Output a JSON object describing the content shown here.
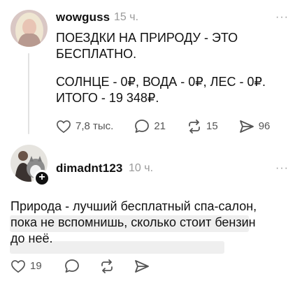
{
  "post1": {
    "author": "wowguss",
    "time": "15 ч.",
    "more_label": "···",
    "text_line1": "ПОЕЗДКИ НА ПРИРОДУ - ЭТО",
    "text_line2": "БЕСПЛАТНО.",
    "text_line3": "СОЛНЦЕ - 0₽, ВОДА - 0₽, ЛЕС - 0₽.",
    "text_line4": "ИТОГО - 19 348₽.",
    "likes": "7,8 тыс.",
    "comments": "21",
    "reposts": "15",
    "shares": "96"
  },
  "post2": {
    "author": "dimadnt123",
    "time": "10 ч.",
    "more_label": "···",
    "plus_label": "+",
    "text_line1": "Природа - лучший бесплатный спа-салон,",
    "text_line2": "пока не вспомнишь, сколько стоит бензин",
    "text_line3": "до неё.",
    "likes": "19"
  },
  "icons": {
    "like": "heart-icon",
    "comment": "comment-bubble-icon",
    "repost": "repost-arrows-icon",
    "share": "send-arrow-icon",
    "more": "more-dots-icon"
  },
  "colors": {
    "text": "#111111",
    "muted": "#9a9a9a",
    "action": "#555555",
    "thread_line": "#e2e2e2",
    "highlight": "#efefef"
  }
}
